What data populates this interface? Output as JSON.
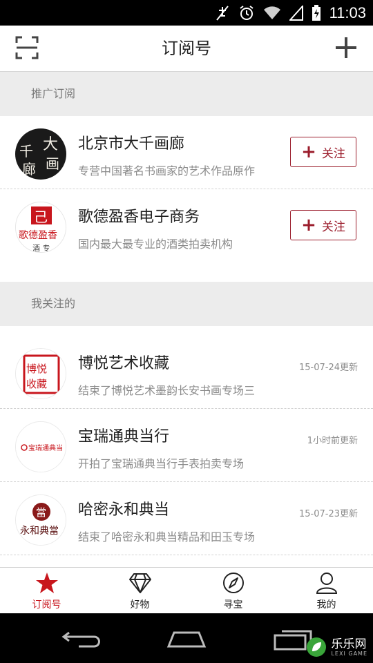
{
  "status_bar": {
    "time": "11:03"
  },
  "header": {
    "title": "订阅号"
  },
  "sections": [
    {
      "label": "推广订阅"
    },
    {
      "label": "我关注的"
    }
  ],
  "promoted": [
    {
      "name": "北京市大千画廊",
      "desc": "专营中国著名书画家的艺术作品原作",
      "follow_label": "关注",
      "logo_text": "大千画廊"
    },
    {
      "name": "歌德盈香电子商务",
      "desc": "国内最大最专业的酒类拍卖机构",
      "follow_label": "关注",
      "logo_text": "歌德盈香"
    }
  ],
  "following": [
    {
      "name": "博悦艺术收藏",
      "desc": "结束了博悦艺术墨韵长安书画专场三",
      "time": "15-07-24更新",
      "logo_text": "博悦艺术收藏"
    },
    {
      "name": "宝瑞通典当行",
      "desc": "开拍了宝瑞通典当行手表拍卖专场",
      "time": "1小时前更新",
      "logo_text": "宝瑞通典当"
    },
    {
      "name": "哈密永和典当",
      "desc": "结束了哈密永和典当精品和田玉专场",
      "time": "15-07-23更新",
      "logo_text": "永和典當"
    }
  ],
  "tabs": [
    {
      "label": "订阅号",
      "icon": "star-icon",
      "active": true
    },
    {
      "label": "好物",
      "icon": "diamond-icon",
      "active": false
    },
    {
      "label": "寻宝",
      "icon": "compass-icon",
      "active": false
    },
    {
      "label": "我的",
      "icon": "person-icon",
      "active": false
    }
  ],
  "watermark": {
    "text": "乐乐网",
    "sub": "LEXI GAME"
  },
  "colors": {
    "accent": "#c8161d",
    "follow": "#9b1d2c",
    "section_bg": "#ececec"
  }
}
